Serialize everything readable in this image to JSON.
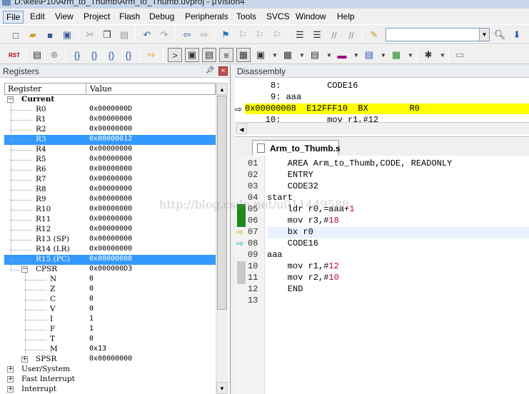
{
  "window": {
    "title": "D:\\keil\\P10\\Arm_to_Thumb\\Arm_to_Thumb.uvproj - µVision4"
  },
  "menu": [
    "File",
    "Edit",
    "View",
    "Project",
    "Flash",
    "Debug",
    "Peripherals",
    "Tools",
    "SVCS",
    "Window",
    "Help"
  ],
  "toolbar": {
    "find_value": "",
    "reset_label": "RST"
  },
  "registers": {
    "title": "Registers",
    "col_register": "Register",
    "col_value": "Value",
    "current_label": "Current",
    "rows": [
      {
        "name": "R0",
        "value": "0x0000000D",
        "selected": false
      },
      {
        "name": "R1",
        "value": "0x00000000",
        "selected": false
      },
      {
        "name": "R2",
        "value": "0x00000000",
        "selected": false
      },
      {
        "name": "R3",
        "value": "0x00000012",
        "selected": true
      },
      {
        "name": "R4",
        "value": "0x00000000",
        "selected": false
      },
      {
        "name": "R5",
        "value": "0x00000000",
        "selected": false
      },
      {
        "name": "R6",
        "value": "0x00000000",
        "selected": false
      },
      {
        "name": "R7",
        "value": "0x00000000",
        "selected": false
      },
      {
        "name": "R8",
        "value": "0x00000000",
        "selected": false
      },
      {
        "name": "R9",
        "value": "0x00000000",
        "selected": false
      },
      {
        "name": "R10",
        "value": "0x00000000",
        "selected": false
      },
      {
        "name": "R11",
        "value": "0x00000000",
        "selected": false
      },
      {
        "name": "R12",
        "value": "0x00000000",
        "selected": false
      },
      {
        "name": "R13 (SP)",
        "value": "0x00000000",
        "selected": false
      },
      {
        "name": "R14 (LR)",
        "value": "0x00000000",
        "selected": false
      },
      {
        "name": "R15 (PC)",
        "value": "0x00000008",
        "selected": true
      }
    ],
    "cpsr": {
      "name": "CPSR",
      "value": "0x000000D3"
    },
    "flags": [
      {
        "name": "N",
        "value": "0"
      },
      {
        "name": "Z",
        "value": "0"
      },
      {
        "name": "C",
        "value": "0"
      },
      {
        "name": "V",
        "value": "0"
      },
      {
        "name": "I",
        "value": "1"
      },
      {
        "name": "F",
        "value": "1"
      },
      {
        "name": "T",
        "value": "0"
      },
      {
        "name": "M",
        "value": "0x13"
      }
    ],
    "spsr": {
      "name": "SPSR",
      "value": "0x00000000"
    },
    "groups": [
      "User/System",
      "Fast Interrupt",
      "Interrupt"
    ]
  },
  "disassembly": {
    "title": "Disassembly",
    "lines": [
      {
        "text": "     8:         CODE16",
        "current": false
      },
      {
        "text": "     9: aaa",
        "current": false
      },
      {
        "text": "0x00000008  E12FFF10  BX        R0",
        "current": true
      },
      {
        "text": "    10:         mov r1,#12",
        "current": false
      }
    ]
  },
  "editor": {
    "tab_label": "Arm_to_Thumb.s",
    "lines": [
      {
        "num": "01",
        "pre": "    AREA Arm_to_Thumb,CODE, READONLY",
        "n": "",
        "post": "",
        "mark": "",
        "hl": false
      },
      {
        "num": "02",
        "pre": "    ENTRY",
        "n": "",
        "post": "",
        "mark": "",
        "hl": false
      },
      {
        "num": "03",
        "pre": "    CODE32",
        "n": "",
        "post": "",
        "mark": "",
        "hl": false
      },
      {
        "num": "04",
        "pre": "start",
        "n": "",
        "post": "",
        "mark": "",
        "hl": false
      },
      {
        "num": "05",
        "pre": "    ldr r0,=aaa+",
        "n": "1",
        "post": "",
        "mark": "green",
        "hl": false
      },
      {
        "num": "06",
        "pre": "    mov r3,#",
        "n": "18",
        "post": "",
        "mark": "green",
        "hl": false
      },
      {
        "num": "07",
        "pre": "    bx r0",
        "n": "",
        "post": "",
        "mark": "yellow-arrow",
        "hl": true
      },
      {
        "num": "08",
        "pre": "    CODE16",
        "n": "",
        "post": "",
        "mark": "cyan-arrow",
        "hl": false
      },
      {
        "num": "09",
        "pre": "aaa",
        "n": "",
        "post": "",
        "mark": "",
        "hl": false
      },
      {
        "num": "10",
        "pre": "    mov r1,#",
        "n": "12",
        "post": "",
        "mark": "gray",
        "hl": false
      },
      {
        "num": "11",
        "pre": "    mov r2,#",
        "n": "10",
        "post": "",
        "mark": "gray",
        "hl": false
      },
      {
        "num": "12",
        "pre": "    END",
        "n": "",
        "post": "",
        "mark": "",
        "hl": false
      },
      {
        "num": "13",
        "pre": "",
        "n": "",
        "post": "",
        "mark": "",
        "hl": false
      }
    ]
  },
  "watermark": "http://blog.csdn.net/u011449588",
  "colors": {
    "selection": "#3399ff",
    "current_line": "#ffff00",
    "number": "#c0005a",
    "exec_mark": "#1e8a1e"
  }
}
